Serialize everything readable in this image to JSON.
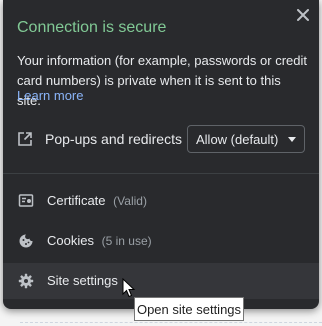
{
  "header": {
    "title": "Connection is secure",
    "description": "Your information (for example, passwords or credit card numbers) is private when it is sent to this site.",
    "learn_more": "Learn more",
    "close_icon": "close-icon"
  },
  "permission": {
    "label": "Pop-ups and redirects",
    "icon": "open-in-new-icon",
    "select_value": "Allow (default)"
  },
  "menu": [
    {
      "label": "Certificate",
      "sub": "(Valid)",
      "icon": "certificate-icon"
    },
    {
      "label": "Cookies",
      "sub": "(5 in use)",
      "icon": "cookie-icon"
    },
    {
      "label": "Site settings",
      "sub": "",
      "icon": "gear-icon"
    }
  ],
  "tooltip": "Open site settings",
  "colors": {
    "panel_bg": "#292a2d",
    "secure_green": "#81c995",
    "link_blue": "#8ab4f8",
    "text": "#e8eaed",
    "secondary_text": "#9aa0a6"
  }
}
